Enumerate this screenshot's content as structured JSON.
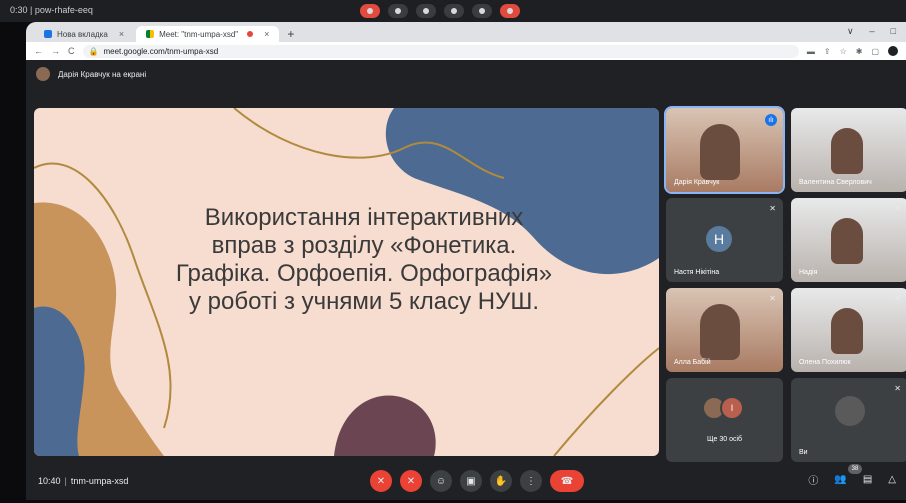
{
  "topbar": {
    "meta": "0:30 | pow-rhafe-eeq"
  },
  "tabs": [
    {
      "label": "Нова вкладка",
      "close": "×"
    },
    {
      "label": "Meet: \"tnm-umpa-xsd\"",
      "close": "×"
    }
  ],
  "new_tab": "+",
  "window_controls": [
    "∨",
    "–",
    "□"
  ],
  "toolbar": {
    "back": "←",
    "forward": "→",
    "reload": "C",
    "lock": "🔒",
    "url": "meet.google.com/tnm-umpa-xsd",
    "icons": [
      "▬",
      "⇪",
      "☆",
      "✱",
      "▢"
    ]
  },
  "presenter_text": "Дарія Кравчук на екрані",
  "slide": {
    "lines": [
      "Використання інтерактивних",
      "вправ з розділу «Фонетика.",
      "Графіка. Орфоепія. Орфографія»",
      "у роботі з учнями 5 класу НУШ."
    ]
  },
  "participants": [
    {
      "name": "Дарія Кравчук",
      "speaking": "ılı"
    },
    {
      "name": "Валентина Сверлович"
    },
    {
      "name": "Настя Нікітіна",
      "initial": "Н",
      "mute": "✕"
    },
    {
      "name": "Надія",
      "mute": "✕"
    },
    {
      "name": "Алла Бабій",
      "mute": "✕"
    },
    {
      "name": "Олена Похилюк",
      "mute": "✕"
    },
    {
      "name": "Ще 30 осіб",
      "initial": "І"
    },
    {
      "name": "Ви",
      "mute": "✕"
    }
  ],
  "meeting": {
    "time": "10:40",
    "sep": "|",
    "code": "tnm-umpa-xsd"
  },
  "controls": [
    "✕",
    "✕",
    "☺",
    "▣",
    "✋",
    "⋮",
    "☎"
  ],
  "right_controls": [
    "ⓘ",
    "👥",
    "▤",
    "△"
  ],
  "people_count": "38",
  "colors": {
    "accent": "#1a73e8",
    "end_call": "#ea4335",
    "slide_bg": "#f6ddd0"
  }
}
